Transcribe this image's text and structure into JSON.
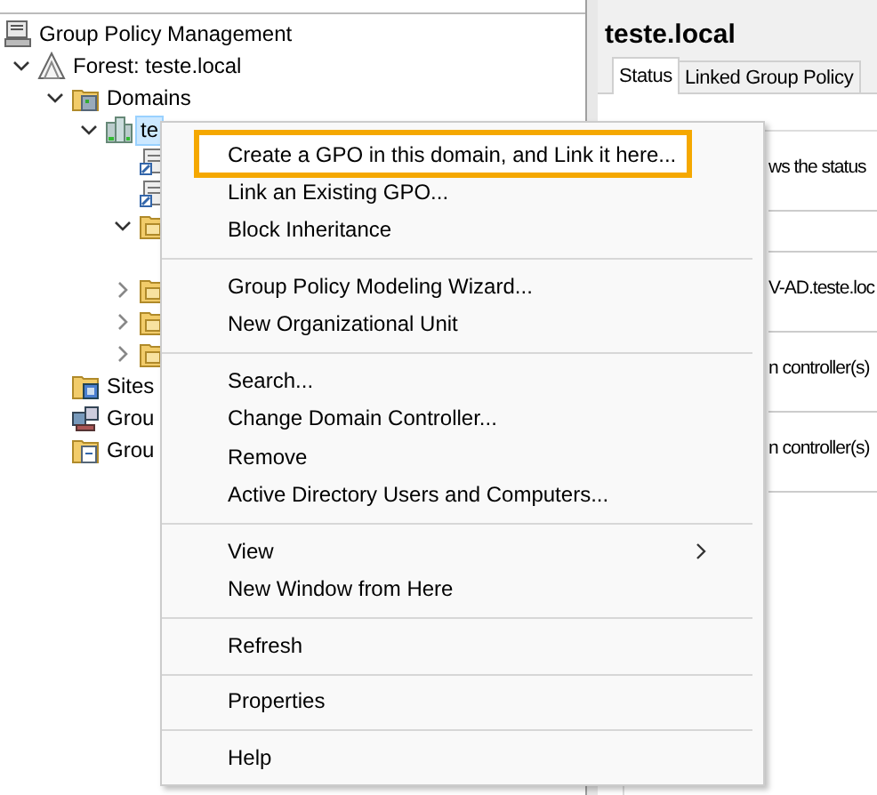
{
  "tree": [
    {
      "label": "Group Policy Management",
      "kind": "console",
      "children": [
        {
          "label": "Forest: teste.local",
          "kind": "forest",
          "expanded": true,
          "children": [
            {
              "label": "Domains",
              "kind": "domains",
              "expanded": true,
              "children": [
                {
                  "label": "te",
                  "kind": "domain",
                  "expanded": true,
                  "selected": true,
                  "children": [
                    {
                      "kind": "link"
                    },
                    {
                      "kind": "link"
                    },
                    {
                      "kind": "folder",
                      "expanded": true
                    },
                    {
                      "kind": "folder",
                      "expanded": false
                    },
                    {
                      "kind": "folder",
                      "expanded": false
                    },
                    {
                      "kind": "folder",
                      "expanded": false
                    }
                  ]
                }
              ]
            },
            {
              "label": "Sites",
              "kind": "sites"
            },
            {
              "label": "Grou",
              "kind": "modeling"
            },
            {
              "label": "Grou",
              "kind": "results"
            }
          ]
        }
      ]
    }
  ],
  "details": {
    "title": "teste.local",
    "tabs": [
      {
        "label": "Status",
        "selected": true
      },
      {
        "label": "Linked Group Policy",
        "selected": false
      }
    ],
    "fragments": [
      "ws the status",
      "V-AD.teste.loc",
      "n controller(s)",
      "n controller(s)"
    ]
  },
  "context_menu": [
    {
      "kind": "item",
      "label": "Create a GPO in this domain, and Link it here...",
      "selected": true
    },
    {
      "kind": "item",
      "label": "Link an Existing GPO...",
      "selected": false
    },
    {
      "kind": "item",
      "label": "Block Inheritance",
      "selected": false
    },
    {
      "kind": "separator"
    },
    {
      "kind": "item",
      "label": "Group Policy Modeling Wizard...",
      "selected": false
    },
    {
      "kind": "item",
      "label": "New Organizational Unit",
      "selected": false
    },
    {
      "kind": "separator"
    },
    {
      "kind": "item",
      "label": "Search...",
      "selected": false
    },
    {
      "kind": "item",
      "label": "Change Domain Controller...",
      "selected": false
    },
    {
      "kind": "item",
      "label": "Remove",
      "selected": false
    },
    {
      "kind": "item",
      "label": "Active Directory Users and Computers...",
      "selected": false
    },
    {
      "kind": "separator"
    },
    {
      "kind": "submenu",
      "label": "View",
      "selected": false
    },
    {
      "kind": "item",
      "label": "New Window from Here",
      "selected": false
    },
    {
      "kind": "separator"
    },
    {
      "kind": "item",
      "label": "Refresh",
      "selected": false
    },
    {
      "kind": "separator"
    },
    {
      "kind": "item",
      "label": "Properties",
      "selected": false
    },
    {
      "kind": "separator"
    },
    {
      "kind": "item",
      "label": "Help",
      "selected": false
    }
  ]
}
